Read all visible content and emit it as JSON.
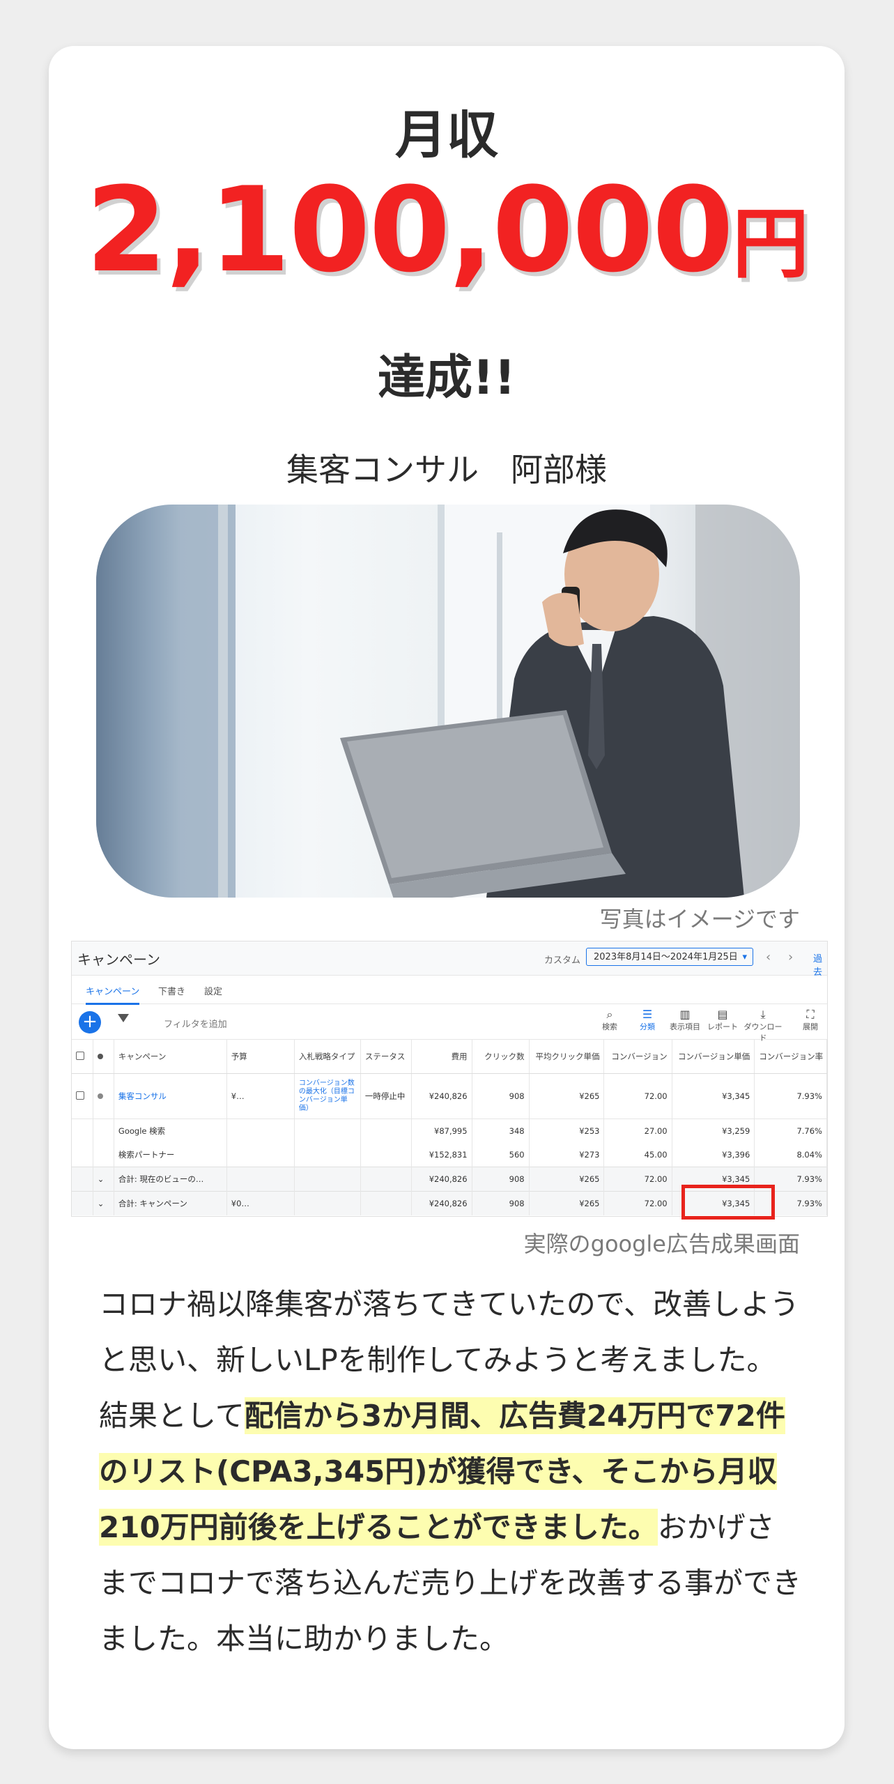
{
  "headline": {
    "label": "月収",
    "amount": "2,100,000",
    "unit": "円",
    "achievement": "達成!!"
  },
  "client": "集客コンサル　阿部様",
  "photo_caption": "写真はイメージです",
  "ads_caption": "実際のgoogle広告成果画面",
  "ads_screen": {
    "title": "キャンペーン",
    "custom_label": "カスタム",
    "date_range": "2023年8月14日～2024年1月25日",
    "past_label": "過去",
    "tabs": [
      "キャンペーン",
      "下書き",
      "設定"
    ],
    "filter_placeholder": "フィルタを追加",
    "tools": [
      "検索",
      "分類",
      "表示項目",
      "レポート",
      "ダウンロード",
      "展開"
    ],
    "columns": [
      "キャンペーン",
      "予算",
      "入札戦略タイプ",
      "ステータス",
      "費用",
      "クリック数",
      "平均クリック単価",
      "コンバージョン",
      "コンバージョン単価",
      "コンバージョン率"
    ],
    "campaign": {
      "name": "集客コンサル",
      "budget": "¥…",
      "bid_strategy": "コンバージョン数の最大化（目標コンバージョン単価）",
      "status": "一時停止中",
      "cost": "¥240,826",
      "clicks": "908",
      "avg_cpc": "¥265",
      "conversions": "72.00",
      "cpa": "¥3,345",
      "cvr": "7.93%"
    },
    "rows": [
      {
        "label": "Google 検索",
        "cost": "¥87,995",
        "clicks": "348",
        "avg_cpc": "¥253",
        "conversions": "27.00",
        "cpa": "¥3,259",
        "cvr": "7.76%"
      },
      {
        "label": "検索パートナー",
        "cost": "¥152,831",
        "clicks": "560",
        "avg_cpc": "¥273",
        "conversions": "45.00",
        "cpa": "¥3,396",
        "cvr": "8.04%"
      }
    ],
    "totals": [
      {
        "label": "合計: 現在のビューの…",
        "budget": "",
        "cost": "¥240,826",
        "clicks": "908",
        "avg_cpc": "¥265",
        "conversions": "72.00",
        "cpa": "¥3,345",
        "cvr": "7.93%"
      },
      {
        "label": "合計: キャンペーン",
        "budget": "¥0…",
        "cost": "¥240,826",
        "clicks": "908",
        "avg_cpc": "¥265",
        "conversions": "72.00",
        "cpa": "¥3,345",
        "cvr": "7.93%"
      }
    ]
  },
  "testimonial": {
    "part1": "コロナ禍以降集客が落ちてきていたので、改善しようと思い、新しいLPを制作してみようと考えました。",
    "part2": "結果として",
    "highlight": "配信から3か月間、広告費24万円で72件のリスト(CPA3,345円)が獲得でき、そこから月収210万円前後を上げることができました。",
    "part3": "おかげさまでコロナで落ち込んだ売り上げを改善する事ができました。本当に助かりました。"
  },
  "colors": {
    "accent_red": "#f22222",
    "highlight_yellow": "#fdfdb0",
    "google_blue": "#1a73e8"
  }
}
